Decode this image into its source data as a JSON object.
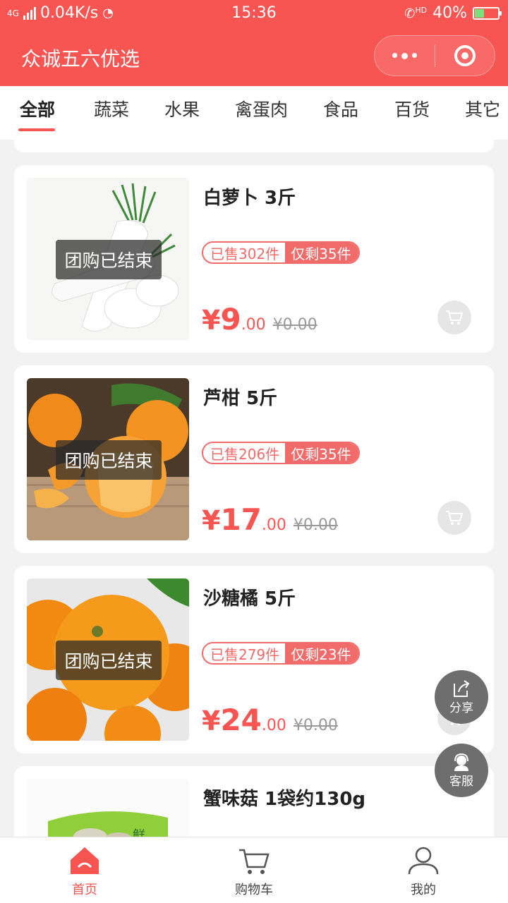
{
  "status_bar": {
    "network": "4G",
    "speed": "0.04K/s",
    "time": "15:36",
    "hd": "HD",
    "battery": "40%",
    "battery_level": 0.4
  },
  "header": {
    "title": "众诚五六优选"
  },
  "tabs": [
    {
      "label": "全部",
      "active": true
    },
    {
      "label": "蔬菜"
    },
    {
      "label": "水果"
    },
    {
      "label": "禽蛋肉"
    },
    {
      "label": "食品"
    },
    {
      "label": "百货"
    },
    {
      "label": "其它"
    }
  ],
  "products": [
    {
      "name": "白萝卜 3斤",
      "ended_label": "团购已结束",
      "sold": "已售302件",
      "remaining": "仅剩35件",
      "yen": "¥",
      "price_int": "9",
      "price_dec": ".00",
      "original": "¥0.00",
      "image": "white-radish"
    },
    {
      "name": "芦柑 5斤",
      "ended_label": "团购已结束",
      "sold": "已售206件",
      "remaining": "仅剩35件",
      "yen": "¥",
      "price_int": "17",
      "price_dec": ".00",
      "original": "¥0.00",
      "image": "ponkan-mandarin"
    },
    {
      "name": "沙糖橘 5斤",
      "ended_label": "团购已结束",
      "sold": "已售279件",
      "remaining": "仅剩23件",
      "yen": "¥",
      "price_int": "24",
      "price_dec": ".00",
      "original": "¥0.00",
      "image": "sugar-tangerine"
    },
    {
      "name": "蟹味菇 1袋约130g",
      "image": "crab-mushroom-pack"
    }
  ],
  "floating": {
    "share": "分享",
    "service": "客服"
  },
  "tabbar": [
    {
      "label": "首页",
      "icon": "home-icon",
      "active": true
    },
    {
      "label": "购物车",
      "icon": "cart-icon"
    },
    {
      "label": "我的",
      "icon": "user-icon"
    }
  ],
  "colors": {
    "brand": "#f85552",
    "tag": "#f26b6b"
  }
}
